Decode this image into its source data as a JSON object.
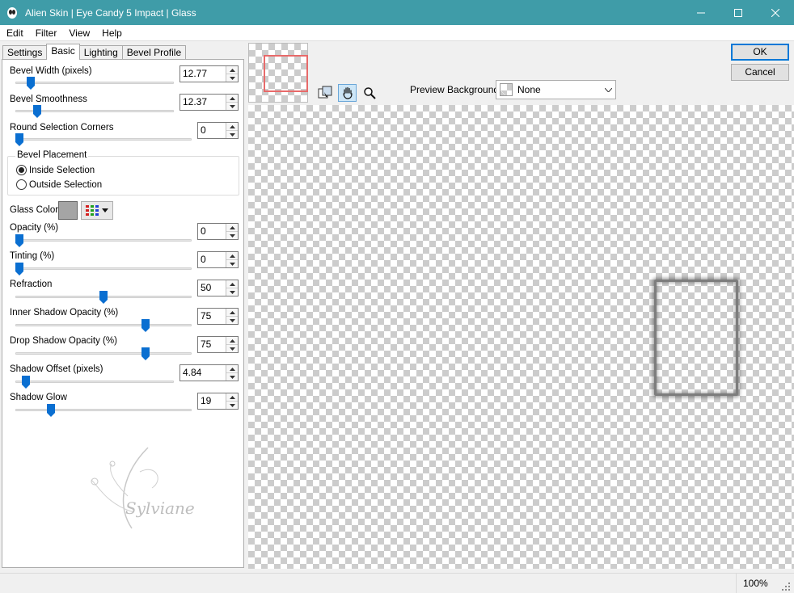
{
  "window": {
    "title": "Alien Skin | Eye Candy 5 Impact | Glass"
  },
  "menu": [
    "Edit",
    "Filter",
    "View",
    "Help"
  ],
  "tabs": [
    "Settings",
    "Basic",
    "Lighting",
    "Bevel Profile"
  ],
  "active_tab": "Basic",
  "params": {
    "bevel_width": {
      "label": "Bevel Width (pixels)",
      "value": "12.77"
    },
    "bevel_smoothness": {
      "label": "Bevel Smoothness",
      "value": "12.37"
    },
    "round_corners": {
      "label": "Round Selection Corners",
      "value": "0"
    },
    "opacity": {
      "label": "Opacity (%)",
      "value": "0"
    },
    "tinting": {
      "label": "Tinting (%)",
      "value": "0"
    },
    "refraction": {
      "label": "Refraction",
      "value": "50"
    },
    "inner_shadow": {
      "label": "Inner Shadow Opacity (%)",
      "value": "75"
    },
    "drop_shadow": {
      "label": "Drop Shadow Opacity (%)",
      "value": "75"
    },
    "shadow_offset": {
      "label": "Shadow Offset (pixels)",
      "value": "4.84"
    },
    "shadow_glow": {
      "label": "Shadow Glow",
      "value": "19"
    }
  },
  "bevel_placement": {
    "title": "Bevel Placement",
    "options": [
      "Inside Selection",
      "Outside Selection"
    ],
    "selected": "Inside Selection"
  },
  "glass_color": {
    "label": "Glass Color",
    "color": "#a5a5a5"
  },
  "watermark_text": "Sylviane",
  "preview_background": {
    "label": "Preview Background:",
    "value": "None"
  },
  "buttons": {
    "ok": "OK",
    "cancel": "Cancel"
  },
  "status": {
    "zoom": "100%"
  },
  "colors": {
    "titlebar": "#3f9ca8",
    "slider_thumb": "#0a6fd1",
    "nav_frame": "#e86a6a"
  }
}
